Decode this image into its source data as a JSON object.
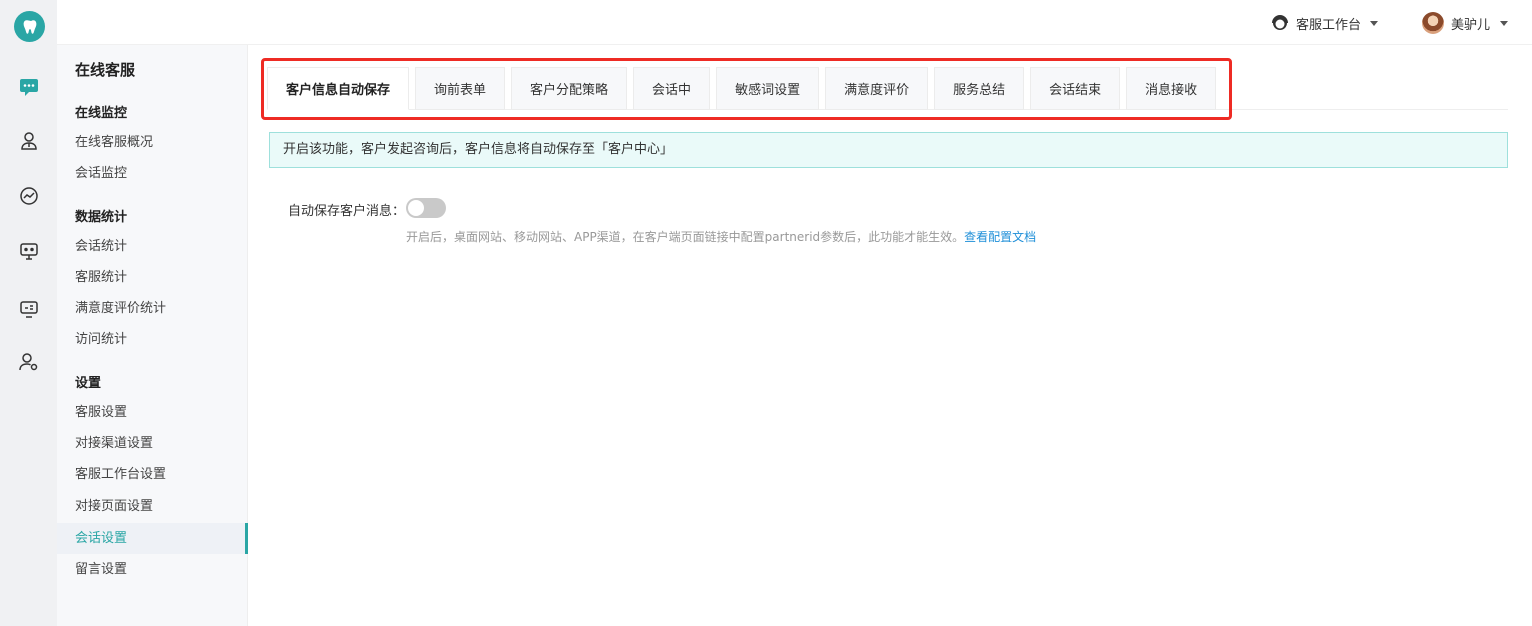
{
  "header": {
    "workbench_label": "客服工作台",
    "workbench_icon": "headset-icon",
    "user_name": "美驴儿"
  },
  "rail": {
    "items": [
      "chat-icon",
      "user-service-icon",
      "chart-icon",
      "monitor-icon",
      "screen-settings-icon",
      "user-settings-icon"
    ]
  },
  "sidebar": {
    "title": "在线客服",
    "groups": [
      {
        "label": "在线监控",
        "items": [
          "在线客服概况",
          "会话监控"
        ]
      },
      {
        "label": "数据统计",
        "items": [
          "会话统计",
          "客服统计",
          "满意度评价统计",
          "访问统计"
        ]
      },
      {
        "label": "设置",
        "items": [
          "客服设置",
          "对接渠道设置",
          "客服工作台设置",
          "对接页面设置",
          "会话设置",
          "留言设置"
        ]
      }
    ],
    "active_item": "会话设置"
  },
  "tabs": [
    "客户信息自动保存",
    "询前表单",
    "客户分配策略",
    "会话中",
    "敏感词设置",
    "满意度评价",
    "服务总结",
    "会话结束",
    "消息接收"
  ],
  "active_tab": "客户信息自动保存",
  "notice": "开启该功能，客户发起咨询后，客户信息将自动保存至「客户中心」",
  "setting": {
    "label": "自动保存客户消息：",
    "enabled": false,
    "hint": "开启后，桌面网站、移动网站、APP渠道，在客户端页面链接中配置partnerid参数后，此功能才能生效。",
    "link": "查看配置文档"
  },
  "colors": {
    "accent": "#2aa6a5",
    "highlight_border": "#ee2b24",
    "link": "#1f8fd8"
  }
}
